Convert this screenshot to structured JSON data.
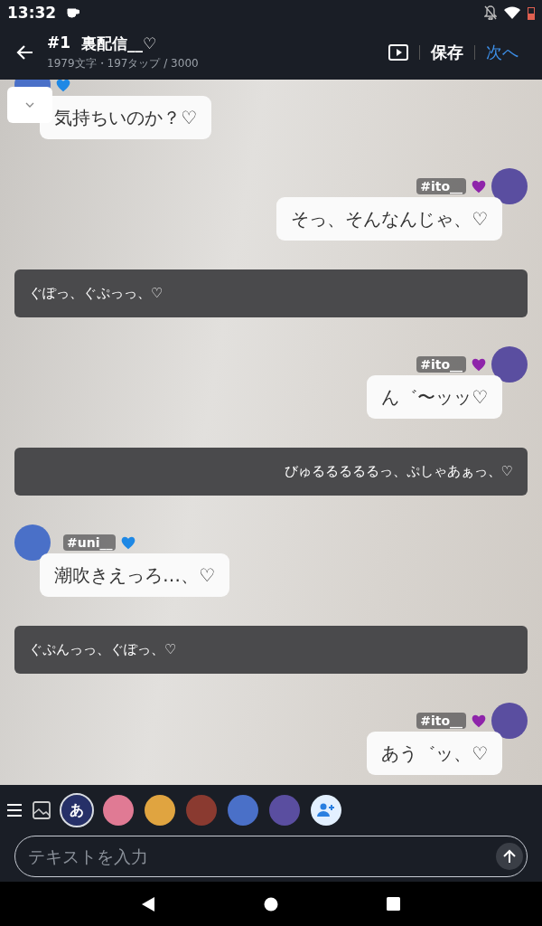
{
  "status_bar": {
    "time": "13:32"
  },
  "header": {
    "number": "#1",
    "title": "裏配信__♡",
    "stats": "1979文字・197タップ / 3000",
    "save": "保存",
    "next": "次へ"
  },
  "messages": [
    {
      "kind": "left",
      "color": "#1e88e5",
      "text": "気持ちいのか？♡",
      "menu": true
    },
    {
      "kind": "right",
      "name": "#ito__",
      "color": "#8e24aa",
      "text": "そっ、そんなんじゃ、♡"
    },
    {
      "kind": "narration_start",
      "text": "ぐぽっ、ぐぷっっ、♡"
    },
    {
      "kind": "right",
      "name": "#ito__",
      "color": "#8e24aa",
      "text": "ん゛〜ッッ♡"
    },
    {
      "kind": "narration_end",
      "text": "びゅるるるるるっ、ぷしゃあぁっ、♡"
    },
    {
      "kind": "left",
      "name": "#uni__",
      "color": "#1e88e5",
      "text": "潮吹きえっろ…、♡"
    },
    {
      "kind": "narration_start",
      "text": "ぐぷんっっ、ぐぽっ、♡"
    },
    {
      "kind": "right",
      "name": "#ito__",
      "color": "#8e24aa",
      "text": "あう゛ッ、♡"
    }
  ],
  "characters": [
    {
      "kind": "text",
      "label": "あ",
      "selected": true
    },
    {
      "kind": "avatar",
      "color": "#e07a94",
      "selected": false
    },
    {
      "kind": "avatar",
      "color": "#e0a440",
      "selected": false
    },
    {
      "kind": "avatar",
      "color": "#8a3a30",
      "selected": false
    },
    {
      "kind": "avatar",
      "color": "#4a70c8",
      "selected": false
    },
    {
      "kind": "avatar",
      "color": "#5a4ea0",
      "selected": false
    }
  ],
  "input": {
    "placeholder": "テキストを入力"
  }
}
